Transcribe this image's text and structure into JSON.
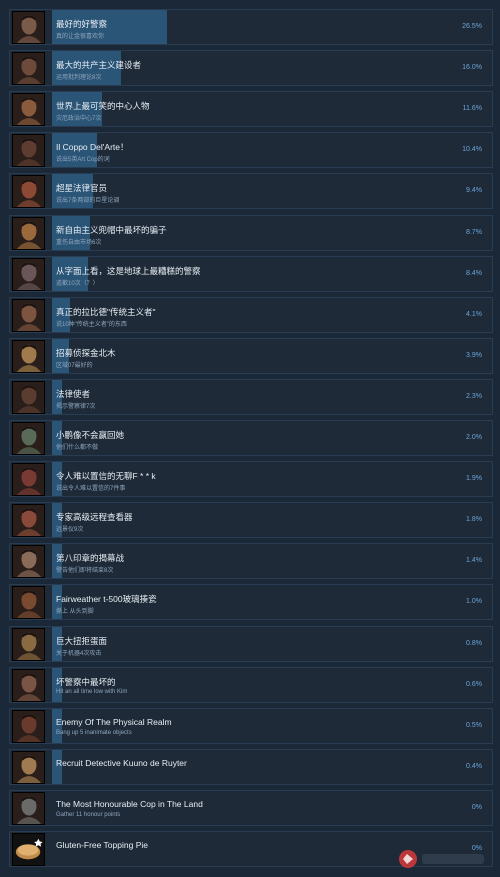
{
  "achievements": [
    {
      "name": "最好的好警察",
      "description": "真的让金很喜欢你",
      "percent_label": "26.5%",
      "percent": 26.5,
      "icon": "portrait-icon",
      "icon_color": "#7a5a48"
    },
    {
      "name": "最大的共产主义建设者",
      "description": "运用批判理论8次",
      "percent_label": "16.0%",
      "percent": 16.0,
      "icon": "portrait-icon",
      "icon_color": "#6d4a3a"
    },
    {
      "name": "世界上最可笑的中心人物",
      "description": "灾厄政治中心7次",
      "percent_label": "11.6%",
      "percent": 11.6,
      "icon": "portrait-icon",
      "icon_color": "#8a5a3c"
    },
    {
      "name": "Il Coppo Del'Arte！",
      "description": "说出5英Art Cop的词",
      "percent_label": "10.4%",
      "percent": 10.4,
      "icon": "portrait-icon",
      "icon_color": "#5e3c30"
    },
    {
      "name": "超星法律官员",
      "description": "说出7条两部的巨星论调",
      "percent_label": "9.4%",
      "percent": 9.4,
      "icon": "portrait-icon",
      "icon_color": "#8c4a34"
    },
    {
      "name": "新自由主义兜帽中最坏的骗子",
      "description": "重伤自由市场6次",
      "percent_label": "8.7%",
      "percent": 8.7,
      "icon": "portrait-icon",
      "icon_color": "#9a6a3c"
    },
    {
      "name": "从字面上看，这是地球上最糟糕的警察",
      "description": "道歉10次（？）",
      "percent_label": "8.4%",
      "percent": 8.4,
      "icon": "portrait-icon",
      "icon_color": "#6a5658"
    },
    {
      "name": "真正的拉比德\"传统主义者\"",
      "description": "说10种\"传统主义者\"的东西",
      "percent_label": "4.1%",
      "percent": 4.1,
      "icon": "portrait-icon",
      "icon_color": "#7c5440"
    },
    {
      "name": "招募侦探金北木",
      "description": "区域07最好的",
      "percent_label": "3.9%",
      "percent": 3.9,
      "icon": "portrait-icon",
      "icon_color": "#a07a4a"
    },
    {
      "name": "法律使者",
      "description": "揭示警察律7次",
      "percent_label": "2.3%",
      "percent": 2.3,
      "icon": "portrait-icon",
      "icon_color": "#5a3c30"
    },
    {
      "name": "小鹏像不会赢回她",
      "description": "他们什么都不做",
      "percent_label": "2.0%",
      "percent": 2.0,
      "icon": "portrait-icon",
      "icon_color": "#5a6a58"
    },
    {
      "name": "令人难以置信的无聊F * * k",
      "description": "说出令人难以置信的7件事",
      "percent_label": "1.9%",
      "percent": 1.9,
      "icon": "portrait-icon",
      "icon_color": "#7a3a34"
    },
    {
      "name": "专家高级远程查看器",
      "description": "远景仪9次",
      "percent_label": "1.8%",
      "percent": 1.8,
      "icon": "portrait-icon",
      "icon_color": "#8a4a3a"
    },
    {
      "name": "第八印章的揭幕战",
      "description": "警告他们即将结束8次",
      "percent_label": "1.4%",
      "percent": 1.4,
      "icon": "portrait-icon",
      "icon_color": "#8a6a58"
    },
    {
      "name": "Fairweather t-500玻璃揍瓷",
      "description": "撕上 从头到脚",
      "percent_label": "1.0%",
      "percent": 1.0,
      "icon": "portrait-icon",
      "icon_color": "#7a4a30"
    },
    {
      "name": "巨大扭拒蛋面",
      "description": "关于机器4次攻击",
      "percent_label": "0.8%",
      "percent": 0.8,
      "icon": "portrait-icon",
      "icon_color": "#8a6a40"
    },
    {
      "name": "坏警察中最坏的",
      "description": "Hit an all time low with Kim",
      "percent_label": "0.6%",
      "percent": 0.6,
      "icon": "portrait-icon",
      "icon_color": "#7a5444"
    },
    {
      "name": "Enemy Of The Physical Realm",
      "description": "Bang up 5 inanimate objects",
      "percent_label": "0.5%",
      "percent": 0.5,
      "icon": "portrait-icon",
      "icon_color": "#6a3a2c"
    },
    {
      "name": "Recruit Detective Kuuno de Ruyter",
      "description": "",
      "percent_label": "0.4%",
      "percent": 0.4,
      "icon": "portrait-icon",
      "icon_color": "#a07a50"
    },
    {
      "name": "The Most Honourable Cop in The Land",
      "description": "Gather 11 honour points",
      "percent_label": "0%",
      "percent": 0,
      "icon": "portrait-icon",
      "icon_color": "#6a6a6a"
    },
    {
      "name": "Gluten-Free Topping Pie",
      "description": "",
      "percent_label": "0%",
      "percent": 0,
      "icon": "pie-icon",
      "icon_color": "#c08a4a"
    }
  ]
}
